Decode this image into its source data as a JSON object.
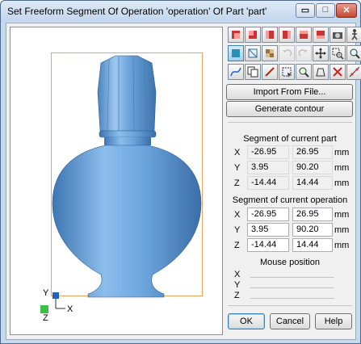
{
  "window": {
    "title": "Set Freeform Segment Of Operation 'operation' Of Part 'part'",
    "minimize_glyph": "▭",
    "maximize_glyph": "□",
    "close_glyph": "✕"
  },
  "toolbar": {
    "row1": [
      "view-front-icon",
      "view-back-icon",
      "view-left-icon",
      "view-right-icon",
      "view-top-icon",
      "view-bottom-icon",
      "camera-icon",
      "walk-icon"
    ],
    "row2": [
      "shaded-icon",
      "wireframe-icon",
      "texture-icon",
      "undo-icon",
      "redo-icon",
      "pan-icon",
      "zoom-window-icon",
      "zoom-icon"
    ],
    "row3": [
      "select-curve-icon",
      "copy-icon",
      "line-tool-icon",
      "select-region-icon",
      "zoom-fit-icon",
      "contour-icon",
      "delete-icon",
      "edit-points-icon"
    ]
  },
  "buttons": {
    "import": "Import From File...",
    "generate": "Generate contour",
    "ok": "OK",
    "cancel": "Cancel",
    "help": "Help"
  },
  "segment_part": {
    "label": "Segment of current part",
    "x_axis": "X",
    "y_axis": "Y",
    "z_axis": "Z",
    "x_min": "-26.95",
    "x_max": "26.95",
    "y_min": "3.95",
    "y_max": "90.20",
    "z_min": "-14.44",
    "z_max": "14.44",
    "unit": "mm"
  },
  "segment_operation": {
    "label": "Segment of current operation",
    "x_axis": "X",
    "y_axis": "Y",
    "z_axis": "Z",
    "x_min": "-26.95",
    "x_max": "26.95",
    "y_min": "3.95",
    "y_max": "90.20",
    "z_min": "-14.44",
    "z_max": "14.44",
    "unit": "mm"
  },
  "mouse_position": {
    "label": "Mouse position",
    "x_axis": "X",
    "y_axis": "Y",
    "z_axis": "Z"
  },
  "triad": {
    "y": "Y",
    "x": "X",
    "z": "Z"
  },
  "colors": {
    "model": "#6aa5dd",
    "triad_x": "#2060c0",
    "triad_z": "#3cc043",
    "bbox": "#f0a35a"
  }
}
